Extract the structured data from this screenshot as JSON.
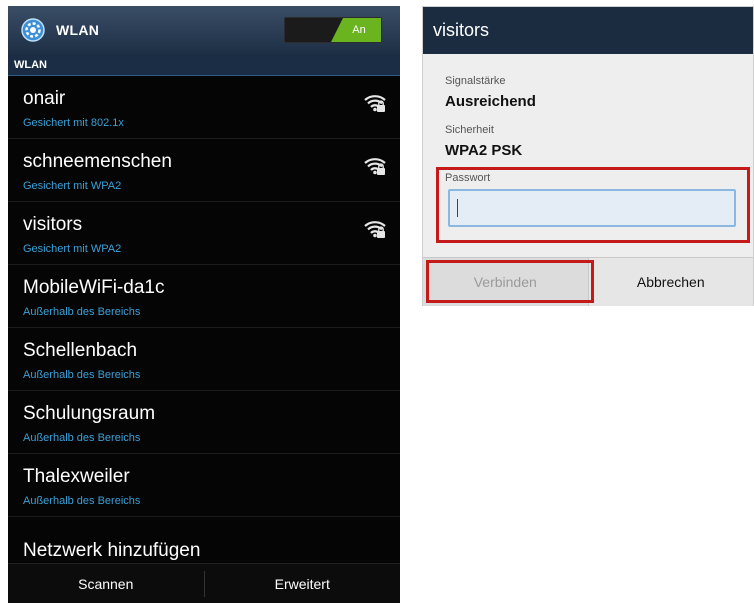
{
  "wifi_settings": {
    "title": "WLAN",
    "toggle_label": "An",
    "section_header": "WLAN",
    "networks": [
      {
        "name": "onair",
        "status": "Gesichert mit 802.1x",
        "secured": true
      },
      {
        "name": "schneemenschen",
        "status": "Gesichert mit WPA2",
        "secured": true
      },
      {
        "name": "visitors",
        "status": "Gesichert mit WPA2",
        "secured": true
      },
      {
        "name": "MobileWiFi-da1c",
        "status": "Außerhalb des Bereichs",
        "secured": false
      },
      {
        "name": "Schellenbach",
        "status": "Außerhalb des Bereichs",
        "secured": false
      },
      {
        "name": "Schulungsraum",
        "status": "Außerhalb des Bereichs",
        "secured": false
      },
      {
        "name": "Thalexweiler",
        "status": "Außerhalb des Bereichs",
        "secured": false
      }
    ],
    "add_network_label": "Netzwerk hinzufügen",
    "bottom_bar": {
      "scan_label": "Scannen",
      "advanced_label": "Erweitert"
    },
    "icons": {
      "settings": "gear-icon",
      "signal": "wifi-lock-icon"
    }
  },
  "connect_dialog": {
    "title": "visitors",
    "signal_label": "Signalstärke",
    "signal_value": "Ausreichend",
    "security_label": "Sicherheit",
    "security_value": "WPA2 PSK",
    "password_label": "Passwort",
    "password_value": "",
    "connect_label": "Verbinden",
    "cancel_label": "Abbrechen"
  },
  "colors": {
    "accent_green": "#6ab41f",
    "status_blue": "#3aa0d8",
    "highlight_red": "#c51a1a",
    "bar_navy": "#1c2c40"
  }
}
